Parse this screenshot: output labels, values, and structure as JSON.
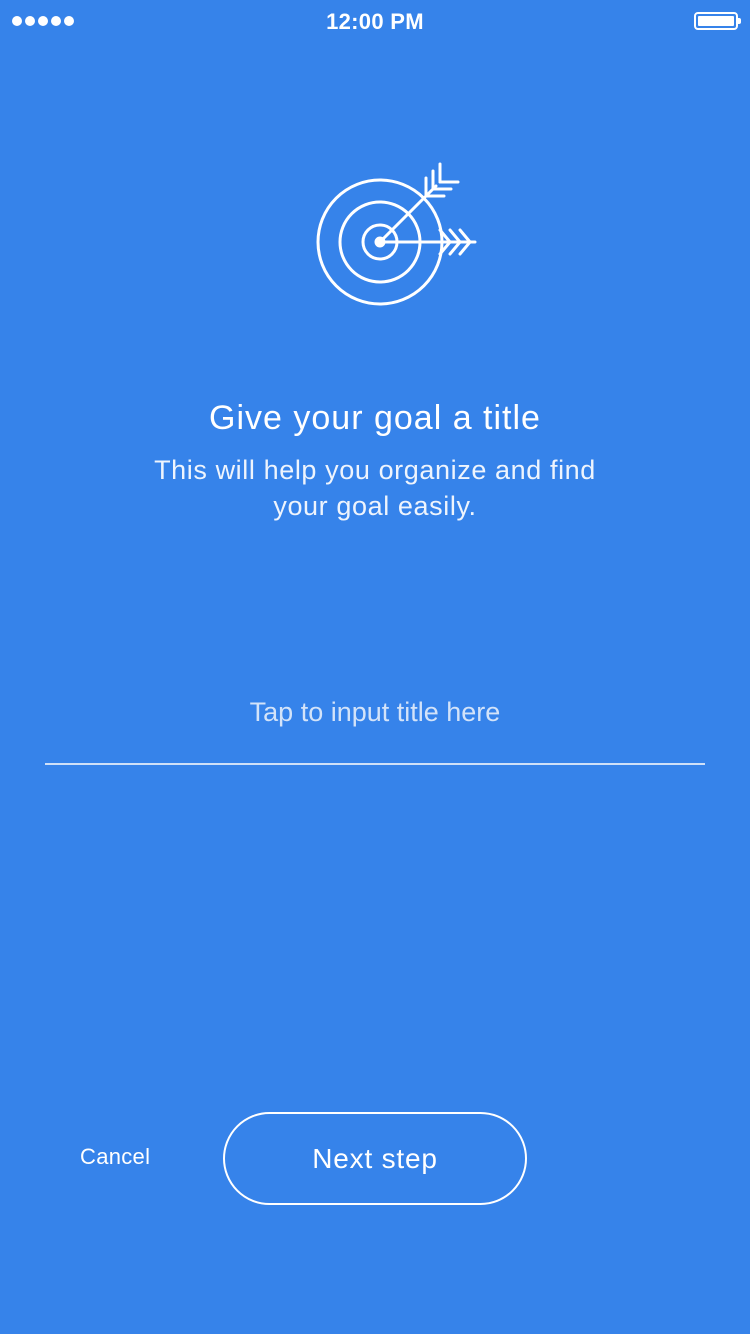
{
  "status_bar": {
    "time": "12:00 PM",
    "signal_icon": "signal-dots-icon",
    "battery_icon": "battery-icon"
  },
  "hero": {
    "icon": "target-arrow-icon",
    "title": "Give your goal a title",
    "subtitle": "This will help you organize and find your goal easily."
  },
  "form": {
    "title_input": {
      "value": "",
      "placeholder": "Tap to input title here"
    }
  },
  "actions": {
    "cancel_label": "Cancel",
    "next_label": "Next step"
  },
  "colors": {
    "background": "#3683ea",
    "foreground": "#ffffff"
  }
}
